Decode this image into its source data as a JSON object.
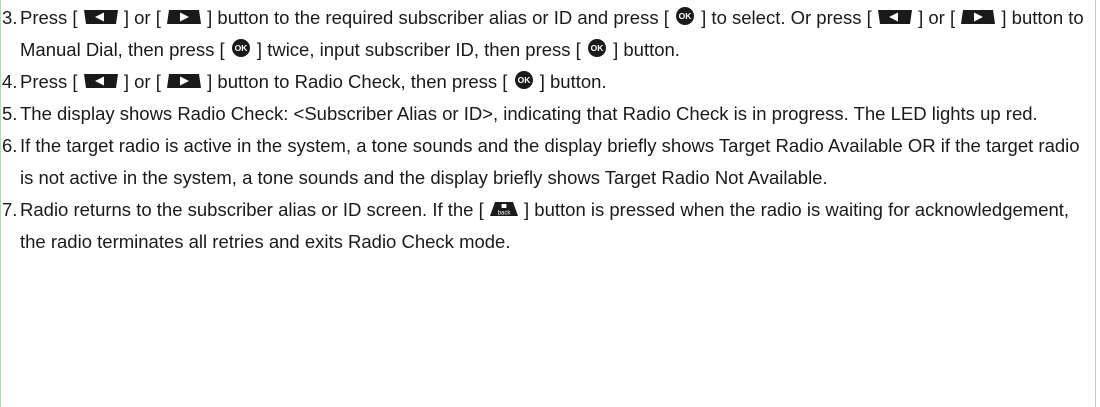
{
  "steps": [
    {
      "number": "3.",
      "parts": {
        "t1": "Press [",
        "t2": "] or [",
        "t3": "] button to the required subscriber alias or ID and press [",
        "t4": "] to select. Or press [",
        "t5": "] or [",
        "t6": "] button to Manual Dial, then press [",
        "t7": "] twice, input subscriber ID, then press [",
        "t8": "] button."
      }
    },
    {
      "number": "4.",
      "parts": {
        "t1": "Press [",
        "t2": "] or [",
        "t3": "] button to Radio Check, then press [",
        "t4": "] button."
      }
    },
    {
      "number": "5.",
      "text": "The display shows Radio Check: <Subscriber Alias or ID>, indicating that Radio Check is in progress. The LED lights up red."
    },
    {
      "number": "6.",
      "text": "If the target radio is active in the system, a tone sounds and the display briefly shows Target Radio Avai­lable OR if the target radio is not active in the system, a tone sounds and the display briefly shows Target Radio Not Available."
    },
    {
      "number": "7.",
      "parts": {
        "t1": "Radio returns to the subscriber alias or ID screen. If the [",
        "t2": "] button is pressed when the radio is waiting for acknowledgement, the radio terminates all retries and exits Radio Check mode."
      }
    }
  ],
  "icons": {
    "left": "left-arrow-key-icon",
    "right": "right-arrow-key-icon",
    "ok": "ok-button-icon",
    "back": "back-button-icon",
    "ok_label": "OK",
    "back_label": "back"
  },
  "colors": {
    "text": "#1a1a1a",
    "key": "#1a1a1a",
    "border": "#bcd3b8"
  }
}
